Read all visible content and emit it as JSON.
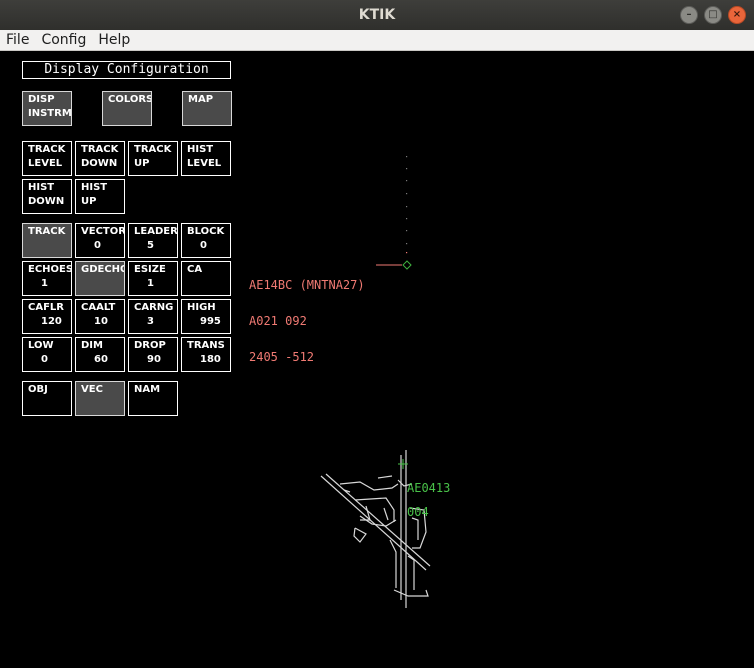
{
  "window": {
    "title": "KTIK"
  },
  "menu": [
    "File",
    "Config",
    "Help"
  ],
  "panel": {
    "title": "Display Configuration",
    "row1": [
      {
        "label": "DISP\nINSTRM",
        "selected": true
      },
      {
        "label": "COLORS",
        "selected": true
      },
      {
        "label": "MAP",
        "selected": true
      }
    ],
    "row2": [
      {
        "label": "TRACK\nLEVEL"
      },
      {
        "label": "TRACK\nDOWN"
      },
      {
        "label": "TRACK\nUP"
      },
      {
        "label": "HIST\nLEVEL"
      }
    ],
    "row3": [
      {
        "label": "HIST\nDOWN"
      },
      {
        "label": "HIST\nUP"
      }
    ],
    "row4": [
      {
        "label": "TRACK",
        "value": "",
        "selected": true
      },
      {
        "label": "VECTOR",
        "value": "0"
      },
      {
        "label": "LEADER",
        "value": "5"
      },
      {
        "label": "BLOCK",
        "value": "0"
      }
    ],
    "row5": [
      {
        "label": "ECHOES",
        "value": "1"
      },
      {
        "label": "GDECHO",
        "value": "",
        "selected": true
      },
      {
        "label": "ESIZE",
        "value": "1"
      },
      {
        "label": "CA",
        "value": ""
      }
    ],
    "row6": [
      {
        "label": "CAFLR",
        "value": "120"
      },
      {
        "label": "CAALT",
        "value": "10"
      },
      {
        "label": "CARNG",
        "value": "3"
      },
      {
        "label": "HIGH",
        "value": "995"
      }
    ],
    "row7": [
      {
        "label": "LOW",
        "value": "0"
      },
      {
        "label": "DIM",
        "value": "60"
      },
      {
        "label": "DROP",
        "value": "90"
      },
      {
        "label": "TRANS",
        "value": "180"
      }
    ],
    "row8": [
      {
        "label": "OBJ"
      },
      {
        "label": "VEC",
        "selected": true
      },
      {
        "label": "NAM"
      }
    ]
  },
  "targets": [
    {
      "id": "AE14BC (MNTNA27)",
      "line2": "A021 092",
      "line3": "2405 -512",
      "color": "#f07a73"
    },
    {
      "id": "AE0413",
      "line2": "004",
      "color": "#49c249"
    }
  ]
}
